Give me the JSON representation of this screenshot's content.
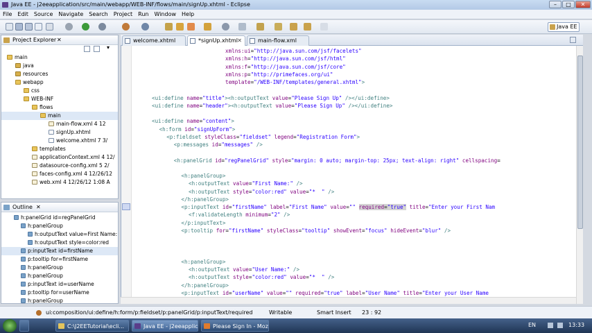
{
  "window": {
    "title": "Java EE - j2eeapplication/src/main/webapp/WEB-INF/flows/main/signUp.xhtml - Eclipse"
  },
  "menu": [
    "File",
    "Edit",
    "Source",
    "Navigate",
    "Search",
    "Project",
    "Run",
    "Window",
    "Help"
  ],
  "perspective": "Java EE",
  "project_explorer": {
    "title": "Project Explorer",
    "items": [
      {
        "label": "main",
        "type": "folder",
        "indent": 0
      },
      {
        "label": "java",
        "type": "pkg",
        "indent": 1
      },
      {
        "label": "resources",
        "type": "pkg",
        "indent": 1
      },
      {
        "label": "webapp",
        "type": "folder",
        "indent": 1
      },
      {
        "label": "css",
        "type": "folder",
        "indent": 2
      },
      {
        "label": "WEB-INF",
        "type": "folder",
        "indent": 2
      },
      {
        "label": "flows",
        "type": "folder",
        "indent": 3
      },
      {
        "label": "main",
        "type": "folder",
        "indent": 4,
        "selected": true
      },
      {
        "label": "main-flow.xml 4 12",
        "type": "xml",
        "indent": 5
      },
      {
        "label": "signUp.xhtml",
        "type": "file",
        "indent": 5
      },
      {
        "label": "welcome.xhtml 7 3/",
        "type": "file",
        "indent": 5
      },
      {
        "label": "templates",
        "type": "folder",
        "indent": 3
      },
      {
        "label": "applicationContext.xml 4 12/",
        "type": "xml",
        "indent": 3
      },
      {
        "label": "datasource-config.xml 5 2/",
        "type": "xml",
        "indent": 3
      },
      {
        "label": "faces-config.xml 4 12/26/12",
        "type": "xml",
        "indent": 3
      },
      {
        "label": "web.xml 4 12/26/12 1:08 A",
        "type": "xml",
        "indent": 3
      }
    ]
  },
  "outline": {
    "title": "Outline",
    "items": [
      {
        "label": "h:panelGrid id=regPanelGrid",
        "indent": 0
      },
      {
        "label": "h:panelGroup",
        "indent": 1
      },
      {
        "label": "h:outputText value=First Name:",
        "indent": 2
      },
      {
        "label": "h:outputText style=color:red",
        "indent": 2
      },
      {
        "label": "p:inputText id=firstName",
        "indent": 1,
        "selected": true
      },
      {
        "label": "p:tooltip for=firstName",
        "indent": 1
      },
      {
        "label": "h:panelGroup",
        "indent": 1
      },
      {
        "label": "h:panelGroup",
        "indent": 1
      },
      {
        "label": "p:inputText id=userName",
        "indent": 1
      },
      {
        "label": "p:tooltip for=userName",
        "indent": 1
      },
      {
        "label": "h:panelGroup",
        "indent": 1
      }
    ]
  },
  "editor": {
    "tabs": [
      {
        "label": "welcome.xhtml",
        "active": false
      },
      {
        "label": "*signUp.xhtml",
        "active": true
      },
      {
        "label": "main-flow.xml",
        "active": false
      }
    ],
    "lines": [
      {
        "indent": 20,
        "segs": [
          {
            "c": "a",
            "t": "xmlns:ui"
          },
          {
            "c": "p",
            "t": "="
          },
          {
            "c": "v",
            "t": "\"http://java.sun.com/jsf/facelets\""
          }
        ]
      },
      {
        "indent": 20,
        "segs": [
          {
            "c": "a",
            "t": "xmlns:h"
          },
          {
            "c": "p",
            "t": "="
          },
          {
            "c": "v",
            "t": "\"http://java.sun.com/jsf/html\""
          }
        ]
      },
      {
        "indent": 20,
        "segs": [
          {
            "c": "a",
            "t": "xmlns:f"
          },
          {
            "c": "p",
            "t": "="
          },
          {
            "c": "v",
            "t": "\"http://java.sun.com/jsf/core\""
          }
        ]
      },
      {
        "indent": 20,
        "segs": [
          {
            "c": "a",
            "t": "xmlns:p"
          },
          {
            "c": "p",
            "t": "="
          },
          {
            "c": "v",
            "t": "\"http://primefaces.org/ui\""
          }
        ]
      },
      {
        "indent": 20,
        "segs": [
          {
            "c": "a",
            "t": "template"
          },
          {
            "c": "p",
            "t": "="
          },
          {
            "c": "v",
            "t": "\"/WEB-INF/templates/general.xhtml\""
          },
          {
            "c": "t",
            "t": ">"
          }
        ]
      },
      {
        "indent": 0,
        "segs": []
      },
      {
        "indent": 0,
        "segs": [
          {
            "c": "t",
            "t": "<ui:define "
          },
          {
            "c": "a",
            "t": "name"
          },
          {
            "c": "p",
            "t": "="
          },
          {
            "c": "v",
            "t": "\"title\""
          },
          {
            "c": "t",
            "t": "><h:outputText "
          },
          {
            "c": "a",
            "t": "value"
          },
          {
            "c": "p",
            "t": "="
          },
          {
            "c": "v",
            "t": "\"Please Sign Up\""
          },
          {
            "c": "t",
            "t": " /></ui:define>"
          }
        ]
      },
      {
        "indent": 0,
        "segs": [
          {
            "c": "t",
            "t": "<ui:define "
          },
          {
            "c": "a",
            "t": "name"
          },
          {
            "c": "p",
            "t": "="
          },
          {
            "c": "v",
            "t": "\"header\""
          },
          {
            "c": "t",
            "t": "><h:outputText "
          },
          {
            "c": "a",
            "t": "value"
          },
          {
            "c": "p",
            "t": "="
          },
          {
            "c": "v",
            "t": "\"Please Sign Up\""
          },
          {
            "c": "t",
            "t": " /></ui:define>"
          }
        ]
      },
      {
        "indent": 0,
        "segs": []
      },
      {
        "indent": 0,
        "segs": [
          {
            "c": "t",
            "t": "<ui:define "
          },
          {
            "c": "a",
            "t": "name"
          },
          {
            "c": "p",
            "t": "="
          },
          {
            "c": "v",
            "t": "\"content\""
          },
          {
            "c": "t",
            "t": ">"
          }
        ]
      },
      {
        "indent": 2,
        "segs": [
          {
            "c": "t",
            "t": "<h:form "
          },
          {
            "c": "a",
            "t": "id"
          },
          {
            "c": "p",
            "t": "="
          },
          {
            "c": "v",
            "t": "\"signUpForm\""
          },
          {
            "c": "t",
            "t": ">"
          }
        ]
      },
      {
        "indent": 4,
        "segs": [
          {
            "c": "t",
            "t": "<p:fieldset "
          },
          {
            "c": "a",
            "t": "styleClass"
          },
          {
            "c": "p",
            "t": "="
          },
          {
            "c": "v",
            "t": "\"fieldset\""
          },
          {
            "c": "a",
            "t": " legend"
          },
          {
            "c": "p",
            "t": "="
          },
          {
            "c": "v",
            "t": "\"Registration Form\""
          },
          {
            "c": "t",
            "t": ">"
          }
        ]
      },
      {
        "indent": 6,
        "segs": [
          {
            "c": "t",
            "t": "<p:messages "
          },
          {
            "c": "a",
            "t": "id"
          },
          {
            "c": "p",
            "t": "="
          },
          {
            "c": "v",
            "t": "\"messages\""
          },
          {
            "c": "t",
            "t": " />"
          }
        ]
      },
      {
        "indent": 0,
        "segs": []
      },
      {
        "indent": 6,
        "segs": [
          {
            "c": "t",
            "t": "<h:panelGrid "
          },
          {
            "c": "a",
            "t": "id"
          },
          {
            "c": "p",
            "t": "="
          },
          {
            "c": "v",
            "t": "\"regPanelGrid\""
          },
          {
            "c": "a",
            "t": " style"
          },
          {
            "c": "p",
            "t": "="
          },
          {
            "c": "v",
            "t": "\"margin: 0 auto; margin-top: 25px; text-align: right\""
          },
          {
            "c": "a",
            "t": " cellspacing"
          },
          {
            "c": "p",
            "t": "="
          }
        ]
      },
      {
        "indent": 0,
        "segs": []
      },
      {
        "indent": 8,
        "segs": [
          {
            "c": "t",
            "t": "<h:panelGroup>"
          }
        ]
      },
      {
        "indent": 10,
        "segs": [
          {
            "c": "t",
            "t": "<h:outputText "
          },
          {
            "c": "a",
            "t": "value"
          },
          {
            "c": "p",
            "t": "="
          },
          {
            "c": "v",
            "t": "\"First Name:\""
          },
          {
            "c": "t",
            "t": " />"
          }
        ]
      },
      {
        "indent": 10,
        "segs": [
          {
            "c": "t",
            "t": "<h:outputText "
          },
          {
            "c": "a",
            "t": "style"
          },
          {
            "c": "p",
            "t": "="
          },
          {
            "c": "v",
            "t": "\"color:red\""
          },
          {
            "c": "a",
            "t": " value"
          },
          {
            "c": "p",
            "t": "="
          },
          {
            "c": "v",
            "t": "\"*  \""
          },
          {
            "c": "t",
            "t": " />"
          }
        ]
      },
      {
        "indent": 8,
        "segs": [
          {
            "c": "t",
            "t": "</h:panelGroup>"
          }
        ]
      },
      {
        "indent": 8,
        "mark": true,
        "segs": [
          {
            "c": "t",
            "t": "<p:inputText "
          },
          {
            "c": "a",
            "t": "id"
          },
          {
            "c": "p",
            "t": "="
          },
          {
            "c": "v",
            "t": "\"firstName\""
          },
          {
            "c": "a",
            "t": " label"
          },
          {
            "c": "p",
            "t": "="
          },
          {
            "c": "v",
            "t": "\"First Name\""
          },
          {
            "c": "a",
            "t": " value"
          },
          {
            "c": "p",
            "t": "="
          },
          {
            "c": "v",
            "t": "\"\""
          },
          {
            "c": "p",
            "t": " "
          },
          {
            "c": "a",
            "t": "required",
            "hl": true
          },
          {
            "c": "p",
            "t": "=",
            "hl": true
          },
          {
            "c": "v",
            "t": "\"true\"",
            "hl": true
          },
          {
            "c": "a",
            "t": " title"
          },
          {
            "c": "p",
            "t": "="
          },
          {
            "c": "v",
            "t": "\"Enter your First Nam"
          }
        ]
      },
      {
        "indent": 10,
        "segs": [
          {
            "c": "t",
            "t": "<f:validateLength "
          },
          {
            "c": "a",
            "t": "minimum"
          },
          {
            "c": "p",
            "t": "="
          },
          {
            "c": "v",
            "t": "\"2\""
          },
          {
            "c": "t",
            "t": " />"
          }
        ]
      },
      {
        "indent": 8,
        "segs": [
          {
            "c": "t",
            "t": "</p:inputText>"
          }
        ]
      },
      {
        "indent": 8,
        "segs": [
          {
            "c": "t",
            "t": "<p:tooltip "
          },
          {
            "c": "a",
            "t": "for"
          },
          {
            "c": "p",
            "t": "="
          },
          {
            "c": "v",
            "t": "\"firstName\""
          },
          {
            "c": "a",
            "t": " styleClass"
          },
          {
            "c": "p",
            "t": "="
          },
          {
            "c": "v",
            "t": "\"tooltip\""
          },
          {
            "c": "a",
            "t": " showEvent"
          },
          {
            "c": "p",
            "t": "="
          },
          {
            "c": "v",
            "t": "\"focus\""
          },
          {
            "c": "a",
            "t": " hideEvent"
          },
          {
            "c": "p",
            "t": "="
          },
          {
            "c": "v",
            "t": "\"blur\""
          },
          {
            "c": "t",
            "t": " />"
          }
        ]
      },
      {
        "indent": 0,
        "segs": []
      },
      {
        "indent": 0,
        "segs": []
      },
      {
        "indent": 0,
        "segs": []
      },
      {
        "indent": 8,
        "segs": [
          {
            "c": "t",
            "t": "<h:panelGroup>"
          }
        ]
      },
      {
        "indent": 10,
        "segs": [
          {
            "c": "t",
            "t": "<h:outputText "
          },
          {
            "c": "a",
            "t": "value"
          },
          {
            "c": "p",
            "t": "="
          },
          {
            "c": "v",
            "t": "\"User Name:\""
          },
          {
            "c": "t",
            "t": " />"
          }
        ]
      },
      {
        "indent": 10,
        "segs": [
          {
            "c": "t",
            "t": "<h:outputText "
          },
          {
            "c": "a",
            "t": "style"
          },
          {
            "c": "p",
            "t": "="
          },
          {
            "c": "v",
            "t": "\"color:red\""
          },
          {
            "c": "a",
            "t": " value"
          },
          {
            "c": "p",
            "t": "="
          },
          {
            "c": "v",
            "t": "\"*  \""
          },
          {
            "c": "t",
            "t": " />"
          }
        ]
      },
      {
        "indent": 8,
        "segs": [
          {
            "c": "t",
            "t": "</h:panelGroup>"
          }
        ]
      },
      {
        "indent": 8,
        "segs": [
          {
            "c": "t",
            "t": "<p:inputText "
          },
          {
            "c": "a",
            "t": "id"
          },
          {
            "c": "p",
            "t": "="
          },
          {
            "c": "v",
            "t": "\"userName\""
          },
          {
            "c": "a",
            "t": " value"
          },
          {
            "c": "p",
            "t": "="
          },
          {
            "c": "v",
            "t": "\"\""
          },
          {
            "c": "a",
            "t": " required"
          },
          {
            "c": "p",
            "t": "="
          },
          {
            "c": "v",
            "t": "\"true\""
          },
          {
            "c": "a",
            "t": " label"
          },
          {
            "c": "p",
            "t": "="
          },
          {
            "c": "v",
            "t": "\"User Name\""
          },
          {
            "c": "a",
            "t": " title"
          },
          {
            "c": "p",
            "t": "="
          },
          {
            "c": "v",
            "t": "\"Enter your User Name"
          }
        ]
      }
    ]
  },
  "status": {
    "path": "ui:composition/ui:define/h:form/p:fieldset/p:panelGrid/p:inputText/required",
    "mode": "Writable",
    "insert": "Smart Insert",
    "position": "23 : 92"
  },
  "taskbar": {
    "tasks": [
      "C:\\J2EETutorial\\ecli...",
      "Java EE - j2eeapplicat...",
      "Please Sign In - Mozi..."
    ],
    "lang": "EN",
    "time": "13:33"
  },
  "colors": {
    "tag": "#3f7f7f",
    "attr": "#7f007f",
    "value": "#2a00ff",
    "selection": "#d4d4d4"
  }
}
